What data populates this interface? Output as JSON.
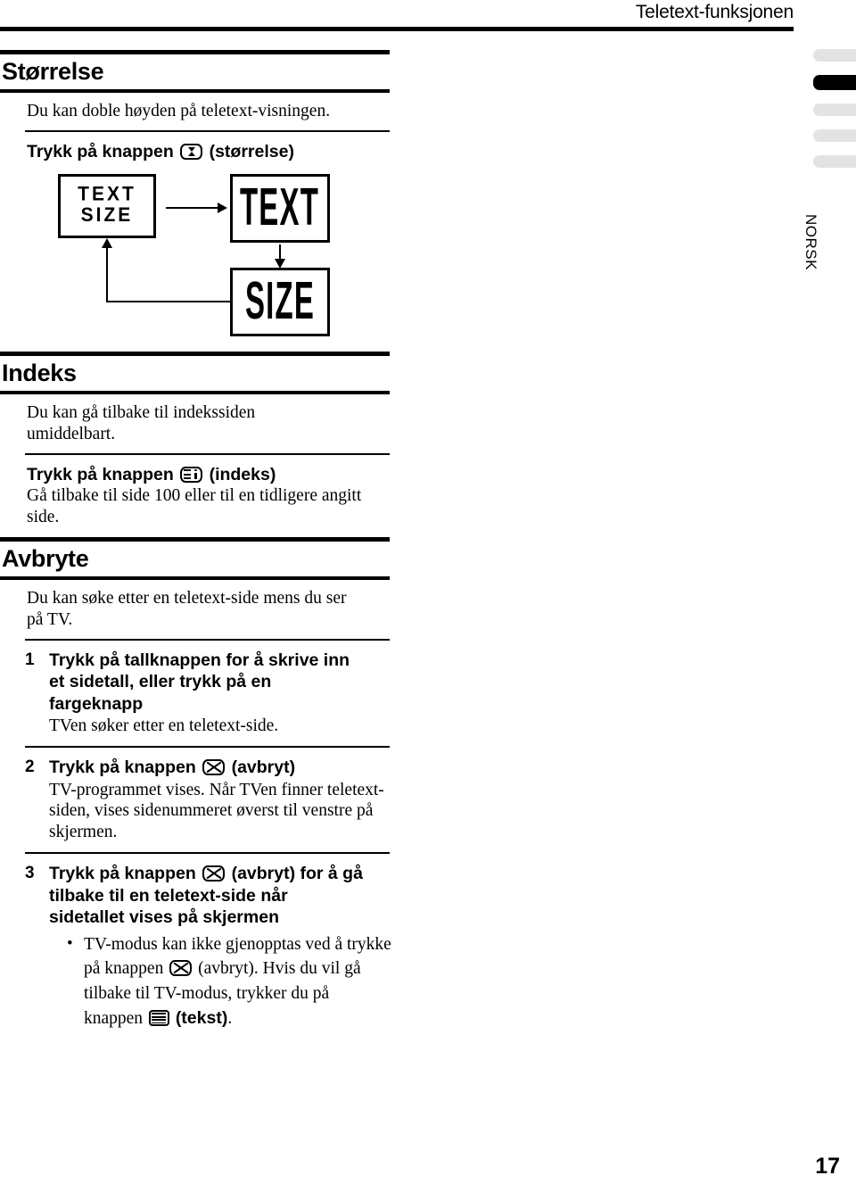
{
  "header": {
    "title": "Teletext-funksjonen"
  },
  "side": {
    "language": "NORSK",
    "tabs": [
      {
        "name": "tab-1",
        "active": false
      },
      {
        "name": "tab-2",
        "active": true
      },
      {
        "name": "tab-3",
        "active": false
      },
      {
        "name": "tab-4",
        "active": false
      },
      {
        "name": "tab-5",
        "active": false
      }
    ]
  },
  "page_number": "17",
  "sections": {
    "size": {
      "title": "Størrelse",
      "intro": "Du kan doble høyden på teletext-visningen.",
      "instruction_pre": "Trykk på knappen",
      "instruction_post": "(størrelse)",
      "icon": "size-icon",
      "diagram": {
        "normal_line1": "TEXT",
        "normal_line2": "SIZE",
        "enlarged_top": "TEXT",
        "enlarged_bottom": "SIZE"
      }
    },
    "index": {
      "title": "Indeks",
      "intro": "Du kan gå tilbake til indekssiden umiddelbart.",
      "instruction_pre": "Trykk på knappen",
      "instruction_post": "(indeks)",
      "icon": "index-icon",
      "instruction_body": "Gå tilbake til side 100 eller til en tidligere angitt side."
    },
    "cancel": {
      "title": "Avbryte",
      "intro": "Du kan søke etter en teletext-side mens du ser på TV.",
      "steps": [
        {
          "number": "1",
          "head_pre": "Trykk på tallknappen for å skrive inn et sidetall, eller trykk på en fargeknapp",
          "head_post": "",
          "icon": "",
          "body": "TVen søker etter en teletext-side."
        },
        {
          "number": "2",
          "head_pre": "Trykk på knappen",
          "head_post": "(avbryt)",
          "icon": "cancel-icon",
          "body": "TV-programmet vises. Når TVen finner teletext-siden, vises sidenummeret øverst til venstre på skjermen."
        },
        {
          "number": "3",
          "head_pre": "Trykk på knappen",
          "head_post": "(avbryt) for å gå tilbake til en teletext-side når sidetallet vises på skjermen",
          "icon": "cancel-icon",
          "bullet": {
            "marker": "•",
            "part1": "TV-modus kan ikke gjenopptas ved å trykke på knappen",
            "part2": "(avbryt). Hvis du vil gå tilbake til TV-modus, trykker du på knappen",
            "part3": "(tekst)",
            "part4": ".",
            "icon1": "cancel-icon",
            "icon2": "text-icon"
          }
        }
      ]
    }
  }
}
